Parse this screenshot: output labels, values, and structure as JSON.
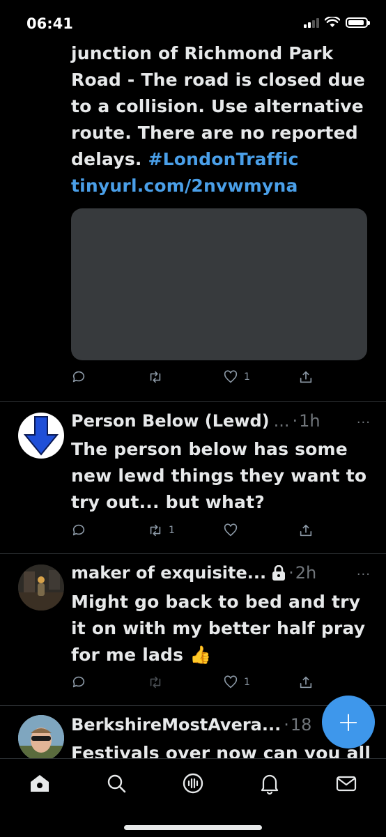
{
  "status_bar": {
    "time": "06:41"
  },
  "colors": {
    "accent": "#3e97eb",
    "link": "#4a9fe8",
    "background": "#000000",
    "muted": "#71767b"
  },
  "tweets": [
    {
      "text_lines": [
        "junction of Richmond Park",
        "Road - The road is closed due",
        "to a collision. Use alternative",
        "route. There are no reported"
      ],
      "text_prefix": "delays. ",
      "hashtag": "#LondonTraffic",
      "url": "tinyurl.com/2nvwmyna",
      "reply_count": "",
      "retweet_count": "",
      "like_count": "1"
    },
    {
      "name": "Person Below (Lewd)",
      "ellipsis": "...",
      "time": "1h",
      "more": "···",
      "text": "The person below has some new lewd things they want to try out... but what?",
      "retweet_count": "1",
      "like_count": ""
    },
    {
      "name": "maker of exquisite...",
      "time": "2h",
      "more": "···",
      "text": "Might go back to bed and try it on with my better half pray for me lads 👍",
      "retweet_count": "",
      "like_count": "1"
    },
    {
      "name": "BerkshireMostAvera...",
      "time": "18",
      "text": "Festivals over now can you all"
    }
  ],
  "fab": {
    "label": "+"
  },
  "tabs": [
    "home-icon",
    "search-icon",
    "spaces-icon",
    "notifications-icon",
    "messages-icon"
  ]
}
